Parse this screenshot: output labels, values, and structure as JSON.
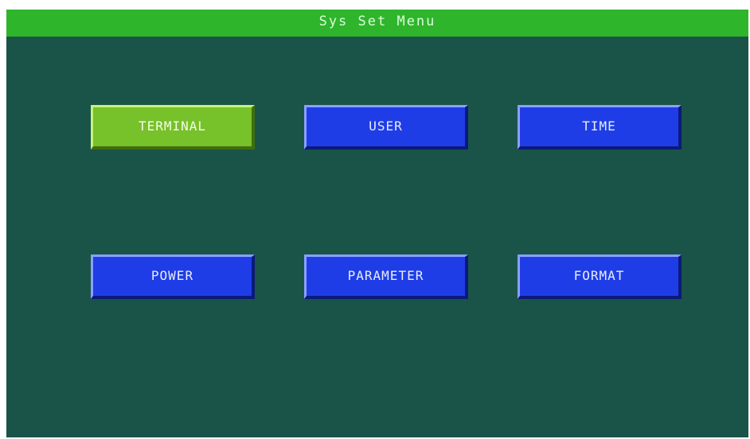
{
  "title": "Sys Set Menu",
  "menu": {
    "row1": [
      {
        "label": "TERMINAL",
        "selected": true
      },
      {
        "label": "USER",
        "selected": false
      },
      {
        "label": "TIME",
        "selected": false
      }
    ],
    "row2": [
      {
        "label": "POWER",
        "selected": false
      },
      {
        "label": "PARAMETER",
        "selected": false
      },
      {
        "label": "FORMAT",
        "selected": false
      }
    ]
  },
  "colors": {
    "background": "#1a5448",
    "title_bar": "#2fb52c",
    "button": "#1f3de6",
    "button_selected": "#77c12a"
  }
}
